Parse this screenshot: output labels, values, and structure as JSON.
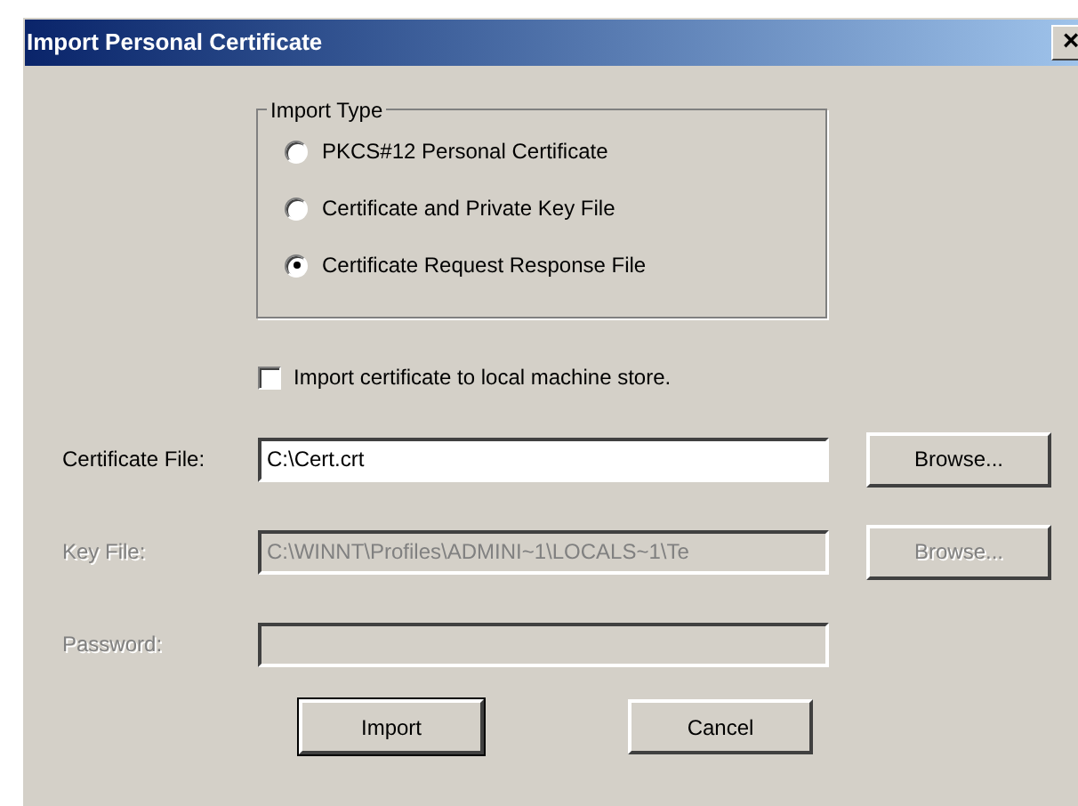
{
  "window": {
    "title": "Import Personal Certificate",
    "close": "×"
  },
  "import_type": {
    "label": "Import Type",
    "options": [
      {
        "label": "PKCS#12 Personal Certificate",
        "selected": false
      },
      {
        "label": "Certificate and Private Key File",
        "selected": false
      },
      {
        "label": "Certificate Request Response File",
        "selected": true
      }
    ]
  },
  "local_store": {
    "label": "Import certificate to local machine store.",
    "checked": false
  },
  "fields": [
    {
      "label": "Certificate File:",
      "value": "C:\\Cert.crt",
      "disabled": false,
      "browse": {
        "label": "Browse..."
      }
    },
    {
      "label": "Key File:",
      "value": "C:\\WINNT\\Profiles\\ADMINI~1\\LOCALS~1\\Te",
      "disabled": true,
      "browse": {
        "label": "Browse..."
      }
    },
    {
      "label": "Password:",
      "disabled": true
    }
  ],
  "buttons": [
    {
      "label": "Import",
      "default": true
    },
    {
      "label": "Cancel",
      "default": false
    }
  ]
}
